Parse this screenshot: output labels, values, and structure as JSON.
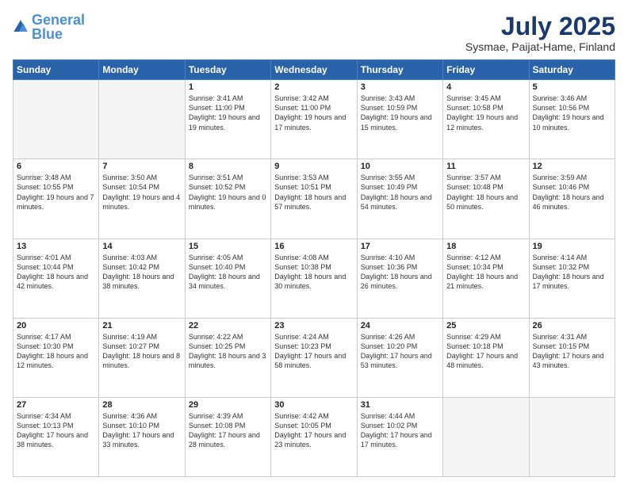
{
  "header": {
    "logo_general": "General",
    "logo_blue": "Blue",
    "month_title": "July 2025",
    "subtitle": "Sysmae, Paijat-Hame, Finland"
  },
  "days_of_week": [
    "Sunday",
    "Monday",
    "Tuesday",
    "Wednesday",
    "Thursday",
    "Friday",
    "Saturday"
  ],
  "weeks": [
    [
      {
        "day": "",
        "info": ""
      },
      {
        "day": "",
        "info": ""
      },
      {
        "day": "1",
        "info": "Sunrise: 3:41 AM\nSunset: 11:00 PM\nDaylight: 19 hours and 19 minutes."
      },
      {
        "day": "2",
        "info": "Sunrise: 3:42 AM\nSunset: 11:00 PM\nDaylight: 19 hours and 17 minutes."
      },
      {
        "day": "3",
        "info": "Sunrise: 3:43 AM\nSunset: 10:59 PM\nDaylight: 19 hours and 15 minutes."
      },
      {
        "day": "4",
        "info": "Sunrise: 3:45 AM\nSunset: 10:58 PM\nDaylight: 19 hours and 12 minutes."
      },
      {
        "day": "5",
        "info": "Sunrise: 3:46 AM\nSunset: 10:56 PM\nDaylight: 19 hours and 10 minutes."
      }
    ],
    [
      {
        "day": "6",
        "info": "Sunrise: 3:48 AM\nSunset: 10:55 PM\nDaylight: 19 hours and 7 minutes."
      },
      {
        "day": "7",
        "info": "Sunrise: 3:50 AM\nSunset: 10:54 PM\nDaylight: 19 hours and 4 minutes."
      },
      {
        "day": "8",
        "info": "Sunrise: 3:51 AM\nSunset: 10:52 PM\nDaylight: 19 hours and 0 minutes."
      },
      {
        "day": "9",
        "info": "Sunrise: 3:53 AM\nSunset: 10:51 PM\nDaylight: 18 hours and 57 minutes."
      },
      {
        "day": "10",
        "info": "Sunrise: 3:55 AM\nSunset: 10:49 PM\nDaylight: 18 hours and 54 minutes."
      },
      {
        "day": "11",
        "info": "Sunrise: 3:57 AM\nSunset: 10:48 PM\nDaylight: 18 hours and 50 minutes."
      },
      {
        "day": "12",
        "info": "Sunrise: 3:59 AM\nSunset: 10:46 PM\nDaylight: 18 hours and 46 minutes."
      }
    ],
    [
      {
        "day": "13",
        "info": "Sunrise: 4:01 AM\nSunset: 10:44 PM\nDaylight: 18 hours and 42 minutes."
      },
      {
        "day": "14",
        "info": "Sunrise: 4:03 AM\nSunset: 10:42 PM\nDaylight: 18 hours and 38 minutes."
      },
      {
        "day": "15",
        "info": "Sunrise: 4:05 AM\nSunset: 10:40 PM\nDaylight: 18 hours and 34 minutes."
      },
      {
        "day": "16",
        "info": "Sunrise: 4:08 AM\nSunset: 10:38 PM\nDaylight: 18 hours and 30 minutes."
      },
      {
        "day": "17",
        "info": "Sunrise: 4:10 AM\nSunset: 10:36 PM\nDaylight: 18 hours and 26 minutes."
      },
      {
        "day": "18",
        "info": "Sunrise: 4:12 AM\nSunset: 10:34 PM\nDaylight: 18 hours and 21 minutes."
      },
      {
        "day": "19",
        "info": "Sunrise: 4:14 AM\nSunset: 10:32 PM\nDaylight: 18 hours and 17 minutes."
      }
    ],
    [
      {
        "day": "20",
        "info": "Sunrise: 4:17 AM\nSunset: 10:30 PM\nDaylight: 18 hours and 12 minutes."
      },
      {
        "day": "21",
        "info": "Sunrise: 4:19 AM\nSunset: 10:27 PM\nDaylight: 18 hours and 8 minutes."
      },
      {
        "day": "22",
        "info": "Sunrise: 4:22 AM\nSunset: 10:25 PM\nDaylight: 18 hours and 3 minutes."
      },
      {
        "day": "23",
        "info": "Sunrise: 4:24 AM\nSunset: 10:23 PM\nDaylight: 17 hours and 58 minutes."
      },
      {
        "day": "24",
        "info": "Sunrise: 4:26 AM\nSunset: 10:20 PM\nDaylight: 17 hours and 53 minutes."
      },
      {
        "day": "25",
        "info": "Sunrise: 4:29 AM\nSunset: 10:18 PM\nDaylight: 17 hours and 48 minutes."
      },
      {
        "day": "26",
        "info": "Sunrise: 4:31 AM\nSunset: 10:15 PM\nDaylight: 17 hours and 43 minutes."
      }
    ],
    [
      {
        "day": "27",
        "info": "Sunrise: 4:34 AM\nSunset: 10:13 PM\nDaylight: 17 hours and 38 minutes."
      },
      {
        "day": "28",
        "info": "Sunrise: 4:36 AM\nSunset: 10:10 PM\nDaylight: 17 hours and 33 minutes."
      },
      {
        "day": "29",
        "info": "Sunrise: 4:39 AM\nSunset: 10:08 PM\nDaylight: 17 hours and 28 minutes."
      },
      {
        "day": "30",
        "info": "Sunrise: 4:42 AM\nSunset: 10:05 PM\nDaylight: 17 hours and 23 minutes."
      },
      {
        "day": "31",
        "info": "Sunrise: 4:44 AM\nSunset: 10:02 PM\nDaylight: 17 hours and 17 minutes."
      },
      {
        "day": "",
        "info": ""
      },
      {
        "day": "",
        "info": ""
      }
    ]
  ]
}
